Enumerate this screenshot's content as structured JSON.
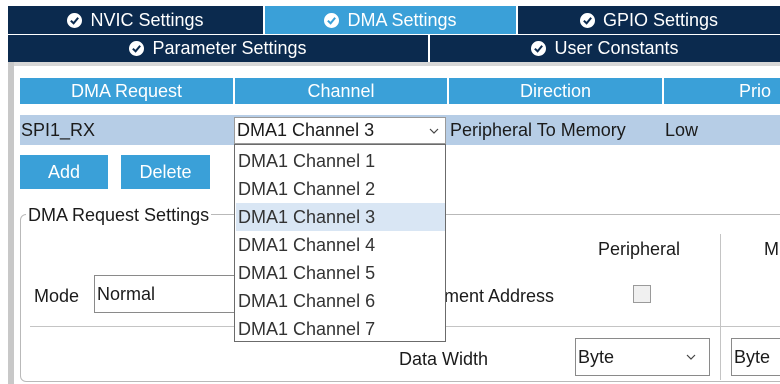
{
  "tabs_row1": [
    {
      "label": "NVIC Settings",
      "active": false
    },
    {
      "label": "DMA Settings",
      "active": true
    },
    {
      "label": "GPIO Settings",
      "active": false
    }
  ],
  "tabs_row2": [
    {
      "label": "Parameter Settings"
    },
    {
      "label": "User Constants"
    }
  ],
  "table": {
    "headers": [
      "DMA Request",
      "Channel",
      "Direction",
      "Prio"
    ],
    "row": {
      "request": "SPI1_RX",
      "channel": "DMA1 Channel 3",
      "direction": "Peripheral To Memory",
      "priority": "Low"
    }
  },
  "buttons": {
    "add": "Add",
    "delete": "Delete"
  },
  "settings": {
    "legend": "DMA Request Settings",
    "mode_label": "Mode",
    "mode_value": "Normal",
    "peripheral_header": "Peripheral",
    "memory_header_partial": "M",
    "increment_address_partial": "ment Address",
    "data_width_label": "Data Width",
    "peripheral_data_width": "Byte",
    "memory_data_width_partial": "Byte"
  },
  "channel_dropdown": {
    "options": [
      "DMA1 Channel 1",
      "DMA1 Channel 2",
      "DMA1 Channel 3",
      "DMA1 Channel 4",
      "DMA1 Channel 5",
      "DMA1 Channel 6",
      "DMA1 Channel 7"
    ],
    "selected_index": 2
  },
  "colors": {
    "tab_dark": "#0b2a4e",
    "accent": "#3aa0d8",
    "row_bg": "#b6cde6",
    "selected_option": "#d9e6f4"
  }
}
